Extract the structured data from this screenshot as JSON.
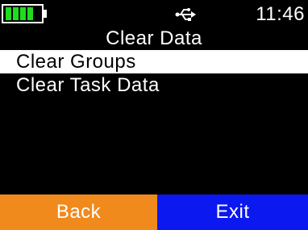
{
  "status": {
    "time": "11:46",
    "battery_icon": "battery-full-icon",
    "usb_icon": "usb-icon",
    "battery_color": "#1edc1e"
  },
  "header": {
    "title": "Clear Data"
  },
  "menu": {
    "items": [
      {
        "label": "Clear Groups",
        "selected": true
      },
      {
        "label": "Clear Task Data",
        "selected": false
      }
    ]
  },
  "softkeys": {
    "left_label": "Back",
    "right_label": "Exit",
    "left_color": "#f08a1c",
    "right_color": "#0b18f0"
  }
}
